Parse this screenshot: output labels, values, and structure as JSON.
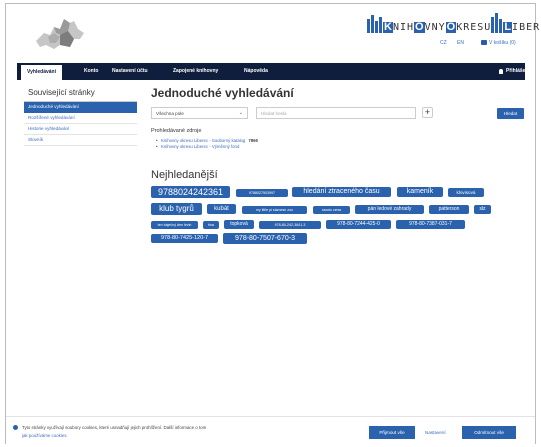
{
  "colors": {
    "brand": "#2a62ad",
    "nav_bg": "#101e3e",
    "link": "#3a6cc0"
  },
  "header": {
    "logo_left_icon": "liberec-region-map-icon",
    "logo_right": {
      "parts": [
        [
          "K",
          "NIH"
        ],
        [
          "O",
          "VNY "
        ],
        [
          "O",
          "KRESU "
        ],
        [
          "L",
          "IBEREC"
        ]
      ]
    },
    "lang_cz": "CZ",
    "lang_en": "EN",
    "cart": "V košíku (0)"
  },
  "nav": {
    "items": [
      "Vyhledávání",
      "Konto",
      "Nastavení účtu",
      "Zapojené knihovny",
      "Nápověda"
    ],
    "login": "Přihlášení"
  },
  "sidebar": {
    "heading": "Související stránky",
    "items": [
      "Jednoduché vyhledávání",
      "Rozšířené vyhledávání",
      "Historie vyhledávání",
      "Slovník"
    ]
  },
  "main": {
    "title": "Jednoduché vyhledávání",
    "select_value": "Všechna pole",
    "search_placeholder": "Hledat hesla",
    "plus": "+",
    "search_button": "Hledat",
    "sources_heading": "Prohledávané zdroje",
    "sources": [
      {
        "name": "Knihovny okresu Liberec - Souborný katalog",
        "count": "7866"
      },
      {
        "name": "Knihovny okresu Liberec - Výměnný fond",
        "count": ""
      }
    ],
    "popular_heading": "Nejhledanější",
    "tags": [
      "9788024242361",
      "9788027503997",
      "hledání ztraceného času",
      "kameník",
      "klovisová",
      "klub tygrů",
      "kubát",
      "my little pi siamese zoo",
      "naruto cenw",
      "pán ledové zahrady",
      "patterson",
      "slz",
      "ten báječný den levin",
      "tina",
      "topková",
      "978-80-242-3641-3",
      "978-80-7244-425-0",
      "978-80-7387-031-7",
      "978-80-7425-120-7",
      "978-80-7507-670-3"
    ]
  },
  "cookie": {
    "text": "Tyto stránky využívají soubory cookies, které usnadňují jejich prohlížení. Další informace o tom",
    "link": "jak používáme cookies.",
    "accept": "Přijmout vše",
    "settings": "Nastavení",
    "reject": "Odmítnout vše"
  }
}
